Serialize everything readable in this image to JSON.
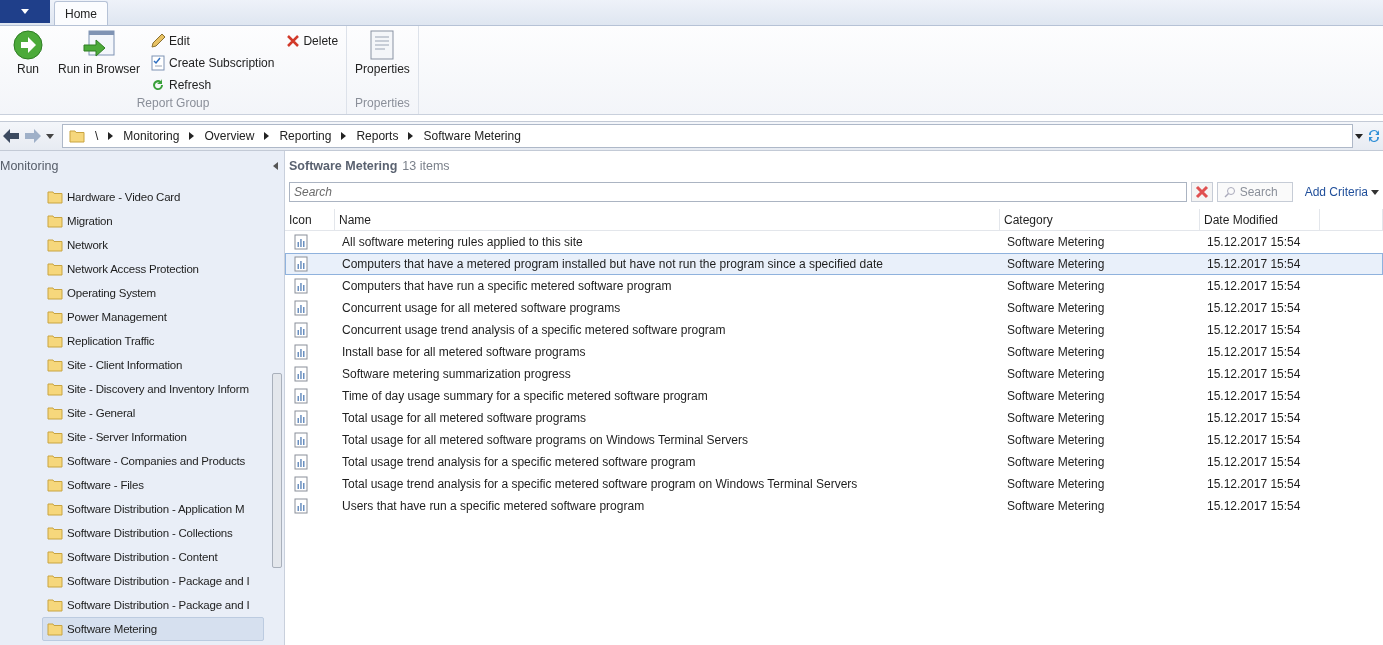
{
  "ribbon": {
    "tabs": [
      {
        "label": "Home",
        "selected": true
      }
    ],
    "groups": [
      {
        "label": "Report Group",
        "large_buttons": [
          {
            "label": "Run",
            "kind": "run"
          },
          {
            "label": "Run in Browser",
            "kind": "browser"
          }
        ],
        "small_buttons": [
          {
            "label": "Edit",
            "kind": "edit"
          },
          {
            "label": "Create Subscription",
            "kind": "subscription"
          },
          {
            "label": "Refresh",
            "kind": "refresh"
          },
          {
            "label": "Delete",
            "kind": "delete"
          }
        ]
      },
      {
        "label": "Properties",
        "large_buttons": [
          {
            "label": "Properties",
            "kind": "properties"
          }
        ]
      }
    ]
  },
  "address_bar": {
    "path": [
      "\\",
      "Monitoring",
      "Overview",
      "Reporting",
      "Reports",
      "Software Metering"
    ]
  },
  "sidebar": {
    "title": "Monitoring",
    "items": [
      {
        "label": "Hardware - Video Card",
        "selected": false
      },
      {
        "label": "Migration",
        "selected": false
      },
      {
        "label": "Network",
        "selected": false
      },
      {
        "label": "Network Access Protection",
        "selected": false
      },
      {
        "label": "Operating System",
        "selected": false
      },
      {
        "label": "Power Management",
        "selected": false
      },
      {
        "label": "Replication Traffic",
        "selected": false
      },
      {
        "label": "Site - Client Information",
        "selected": false
      },
      {
        "label": "Site - Discovery and Inventory Inform",
        "selected": false
      },
      {
        "label": "Site - General",
        "selected": false
      },
      {
        "label": "Site - Server Information",
        "selected": false
      },
      {
        "label": "Software - Companies and Products",
        "selected": false
      },
      {
        "label": "Software - Files",
        "selected": false
      },
      {
        "label": "Software Distribution - Application M",
        "selected": false
      },
      {
        "label": "Software Distribution - Collections",
        "selected": false
      },
      {
        "label": "Software Distribution - Content",
        "selected": false
      },
      {
        "label": "Software Distribution - Package and I",
        "selected": false
      },
      {
        "label": "Software Distribution - Package and I",
        "selected": false
      },
      {
        "label": "Software Metering",
        "selected": true
      }
    ]
  },
  "content": {
    "title": "Software Metering",
    "count": "13 items",
    "search": {
      "placeholder": "Search",
      "button": "Search",
      "add_criteria": "Add Criteria"
    },
    "table": {
      "columns": [
        "Icon",
        "Name",
        "Category",
        "Date Modified"
      ],
      "rows": [
        {
          "name": "All software metering rules applied to this site",
          "category": "Software Metering",
          "date": "15.12.2017 15:54",
          "selected": false
        },
        {
          "name": "Computers that have a metered program installed but have not run the program since a specified date",
          "category": "Software Metering",
          "date": "15.12.2017 15:54",
          "selected": true
        },
        {
          "name": "Computers that have run a specific metered software program",
          "category": "Software Metering",
          "date": "15.12.2017 15:54",
          "selected": false
        },
        {
          "name": "Concurrent usage for all metered software programs",
          "category": "Software Metering",
          "date": "15.12.2017 15:54",
          "selected": false
        },
        {
          "name": "Concurrent usage trend analysis of a specific metered software program",
          "category": "Software Metering",
          "date": "15.12.2017 15:54",
          "selected": false
        },
        {
          "name": "Install base for all metered software programs",
          "category": "Software Metering",
          "date": "15.12.2017 15:54",
          "selected": false
        },
        {
          "name": "Software metering summarization progress",
          "category": "Software Metering",
          "date": "15.12.2017 15:54",
          "selected": false
        },
        {
          "name": "Time of day usage summary for a specific metered software program",
          "category": "Software Metering",
          "date": "15.12.2017 15:54",
          "selected": false
        },
        {
          "name": "Total usage for all metered software programs",
          "category": "Software Metering",
          "date": "15.12.2017 15:54",
          "selected": false
        },
        {
          "name": "Total usage for all metered software programs on Windows Terminal Servers",
          "category": "Software Metering",
          "date": "15.12.2017 15:54",
          "selected": false
        },
        {
          "name": "Total usage trend analysis for a specific metered software program",
          "category": "Software Metering",
          "date": "15.12.2017 15:54",
          "selected": false
        },
        {
          "name": "Total usage trend analysis for a specific metered software program on Windows Terminal Servers",
          "category": "Software Metering",
          "date": "15.12.2017 15:54",
          "selected": false
        },
        {
          "name": "Users that have run a specific metered software program",
          "category": "Software Metering",
          "date": "15.12.2017 15:54",
          "selected": false
        }
      ]
    }
  }
}
